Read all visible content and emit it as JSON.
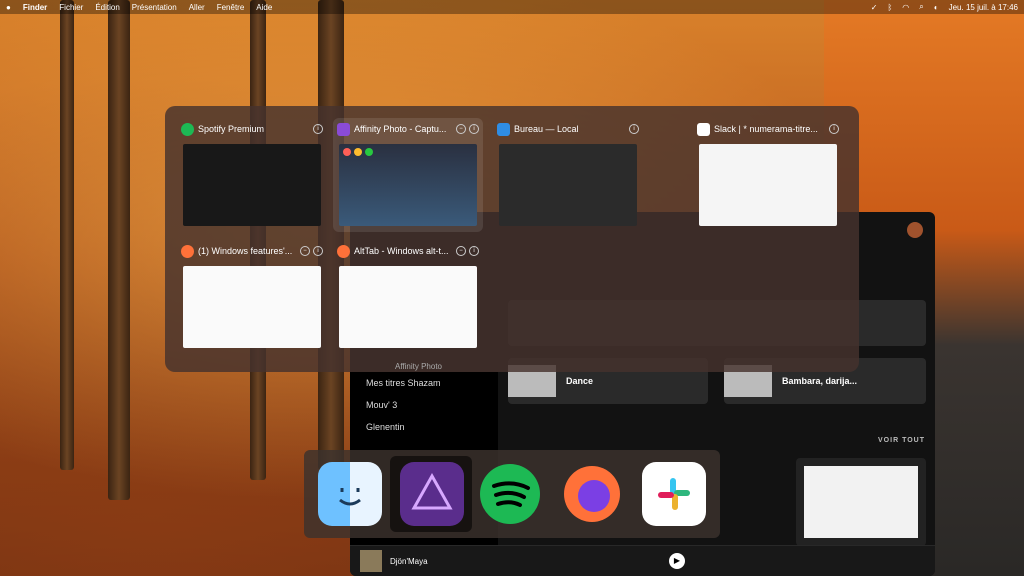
{
  "menubar": {
    "apple": "",
    "app": "Finder",
    "items": [
      "Fichier",
      "Édition",
      "Présentation",
      "Aller",
      "Fenêtre",
      "Aide"
    ],
    "datetime": "Jeu. 15 juil. à 17:46"
  },
  "alttab": {
    "windows": [
      {
        "title": "Spotify Premium",
        "icon": "spotify-icon",
        "color": "#1db954"
      },
      {
        "title": "Affinity Photo - Captu...",
        "icon": "affinity-photo-icon",
        "color": "#8a4bd6",
        "selected": true
      },
      {
        "title": "Bureau — Local",
        "icon": "finder-icon",
        "color": "#2f8de4"
      },
      {
        "title": "Slack | * numerama-titre...",
        "icon": "slack-icon",
        "color": "#ffffff"
      },
      {
        "title": "(1) Windows features'...",
        "icon": "firefox-icon",
        "color": "#ff7139"
      },
      {
        "title": "AltTab - Windows alt-t...",
        "icon": "firefox-icon",
        "color": "#ff7139"
      }
    ],
    "hover_label": "Affinity Photo"
  },
  "spotify": {
    "sidebar": [
      "Mes titres Shazam",
      "Mouv' 3",
      "Glenentin"
    ],
    "cards": [
      "Dance",
      "Bambara, darija..."
    ],
    "voir_tout": "VOIR TOUT",
    "now_playing": "Djön'Maya"
  },
  "dock": {
    "apps": [
      "finder-icon",
      "affinity-photo-icon",
      "spotify-icon",
      "firefox-icon",
      "slack-icon"
    ]
  }
}
